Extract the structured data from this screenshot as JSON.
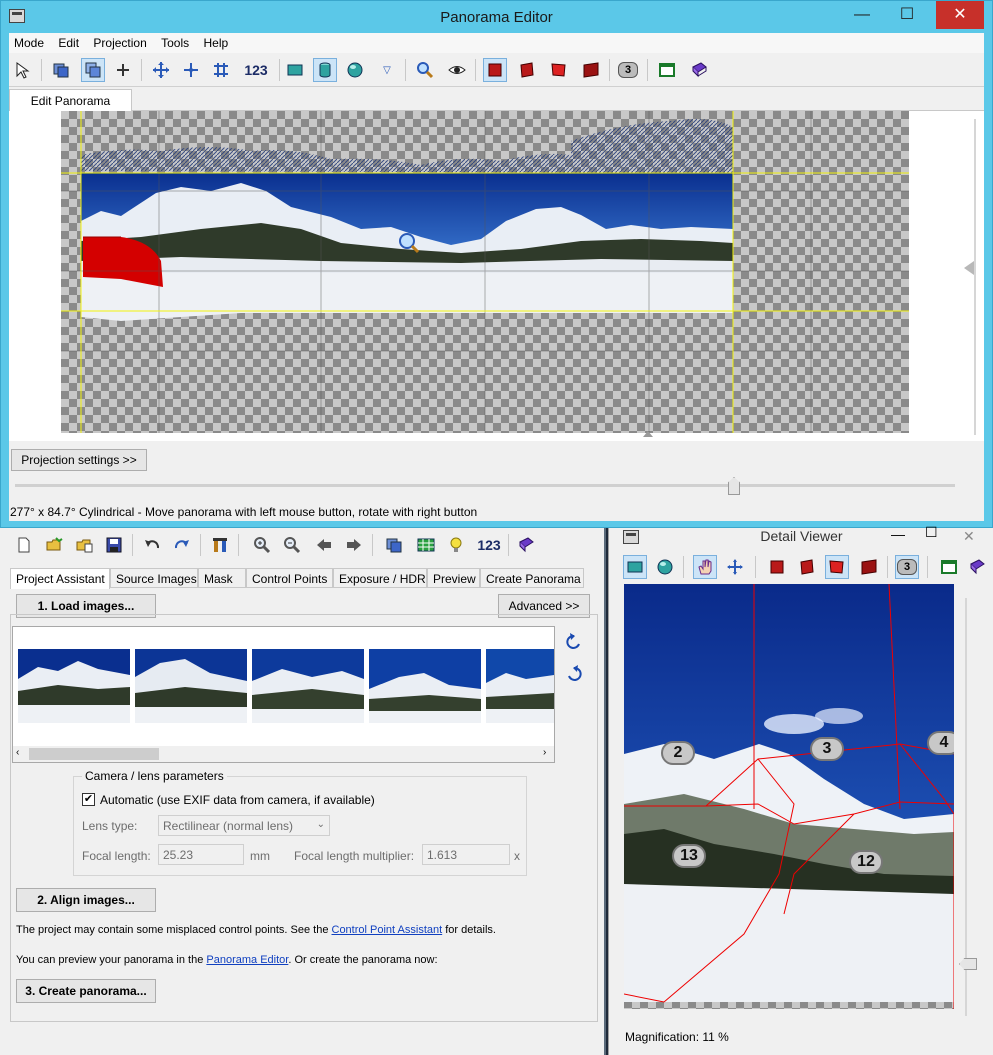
{
  "pano": {
    "title": "Panorama Editor",
    "menu": [
      "Mode",
      "Edit",
      "Projection",
      "Tools",
      "Help"
    ],
    "toolbar_num": "123",
    "cp_badge": "3",
    "tab": "Edit Panorama",
    "projection_btn": "Projection settings >>",
    "status": "277° x 84.7° Cylindrical - Move panorama with left mouse button, rotate with right button"
  },
  "main": {
    "toolbar_num": "123",
    "tabs": [
      "Project Assistant",
      "Source Images",
      "Mask",
      "Control Points",
      "Exposure / HDR",
      "Preview",
      "Create Panorama"
    ],
    "load_btn": "1. Load images...",
    "advanced_btn": "Advanced >>",
    "camera_group": "Camera / lens parameters",
    "auto_label": "Automatic (use EXIF data from camera, if available)",
    "lens_type_label": "Lens type:",
    "lens_type_value": "Rectilinear (normal lens)",
    "focal_label": "Focal length:",
    "focal_value": "25.23",
    "focal_unit": "mm",
    "mult_label": "Focal length multiplier:",
    "mult_value": "1.613",
    "mult_unit": "x",
    "align_btn": "2. Align images...",
    "msg1_pre": "The project may contain some misplaced control points. See the ",
    "msg1_link": "Control Point Assistant",
    "msg1_post": " for details.",
    "msg2_pre": "You can preview your panorama in the ",
    "msg2_link": "Panorama Editor",
    "msg2_post": ". Or create the panorama now:",
    "create_btn": "3. Create panorama..."
  },
  "detail": {
    "title": "Detail Viewer",
    "cp_badge": "3",
    "points": [
      "2",
      "3",
      "4",
      "13",
      "12"
    ],
    "magnification": "Magnification: 11 %"
  },
  "colors": {
    "title_bar": "#5bc8e8",
    "close": "#c7302a",
    "sky": "#0b3fa6",
    "mask_red": "#d40000",
    "guide_yellow": "#f2f20a"
  }
}
